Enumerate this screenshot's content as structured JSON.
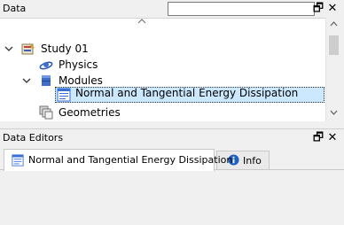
{
  "data_panel": {
    "title": "Data",
    "search": {
      "value": "",
      "placeholder": ""
    },
    "restore_glyph": "🗗",
    "close_glyph": "✕",
    "tree": {
      "study": {
        "label": "Study 01",
        "icon": "study-icon",
        "expanded": true
      },
      "physics": {
        "label": "Physics",
        "icon": "physics-icon"
      },
      "modules": {
        "label": "Modules",
        "icon": "modules-icon",
        "expanded": true
      },
      "selected_module": {
        "label": "Normal and Tangential Energy Dissipation",
        "icon": "document-icon",
        "selected": true
      },
      "geometries": {
        "label": "Geometries",
        "icon": "geometries-icon"
      }
    }
  },
  "editors_panel": {
    "title": "Data Editors",
    "restore_glyph": "🗗",
    "close_glyph": "✕",
    "tabs": [
      {
        "label": "Normal and Tangential Energy Dissipation",
        "icon": "document-icon",
        "active": true
      },
      {
        "label": "Info",
        "icon": "info-icon",
        "active": false
      }
    ]
  },
  "colors": {
    "selection": "#cce8ff",
    "info_blue": "#1f5fbf",
    "panel_bg": "#f0f0f0"
  }
}
